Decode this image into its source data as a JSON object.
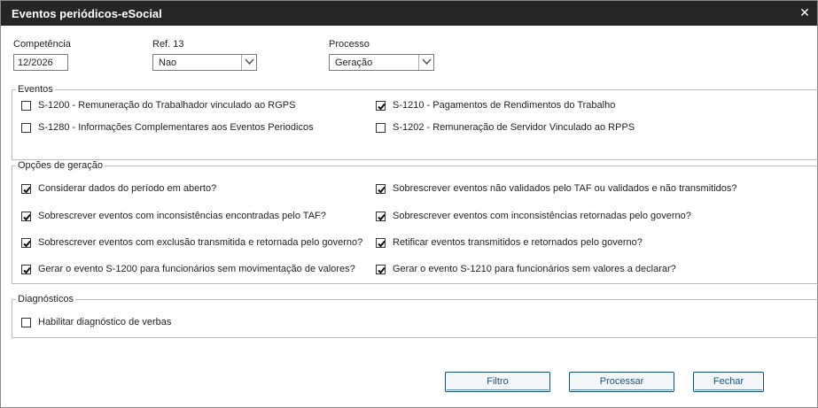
{
  "window": {
    "title": "Eventos periódicos-eSocial",
    "close_icon": "close-icon"
  },
  "header": {
    "competencia": {
      "label": "Competência",
      "value": "12/2026"
    },
    "ref13": {
      "label": "Ref. 13",
      "value": "Nao"
    },
    "processo": {
      "label": "Processo",
      "value": "Geração"
    }
  },
  "eventos": {
    "legend": "Eventos",
    "items": [
      {
        "label": "S-1200 - Remuneração do Trabalhador vinculado ao RGPS",
        "checked": false
      },
      {
        "label": "S-1210 - Pagamentos de Rendimentos do Trabalho",
        "checked": true
      },
      {
        "label": "S-1280 - Informações Complementares aos Eventos Periodicos",
        "checked": false
      },
      {
        "label": "S-1202 - Remuneração de Servidor Vinculado ao RPPS",
        "checked": false
      }
    ]
  },
  "opcoes": {
    "legend": "Opções de geração",
    "items": [
      {
        "label": "Considerar dados do período em aberto?",
        "checked": true
      },
      {
        "label": "Sobrescrever eventos não validados pelo TAF ou validados e não transmitidos?",
        "checked": true
      },
      {
        "label": "Sobrescrever eventos com inconsistências encontradas pelo TAF?",
        "checked": true
      },
      {
        "label": "Sobrescrever eventos com inconsistências retornadas pelo governo?",
        "checked": true
      },
      {
        "label": "Sobrescrever eventos com exclusão transmitida e retornada pelo governo?",
        "checked": true
      },
      {
        "label": "Retificar eventos transmitidos e retornados pelo governo?",
        "checked": true
      },
      {
        "label": "Gerar o evento S-1200 para funcionários sem movimentação de valores?",
        "checked": true
      },
      {
        "label": "Gerar o evento S-1210 para funcionários sem valores a declarar?",
        "checked": true
      }
    ]
  },
  "diagnosticos": {
    "legend": "Diagnósticos",
    "items": [
      {
        "label": "Habilitar diagnóstico de verbas",
        "checked": false
      }
    ]
  },
  "buttons": {
    "filtro": "Filtro",
    "processar": "Processar",
    "fechar": "Fechar"
  }
}
